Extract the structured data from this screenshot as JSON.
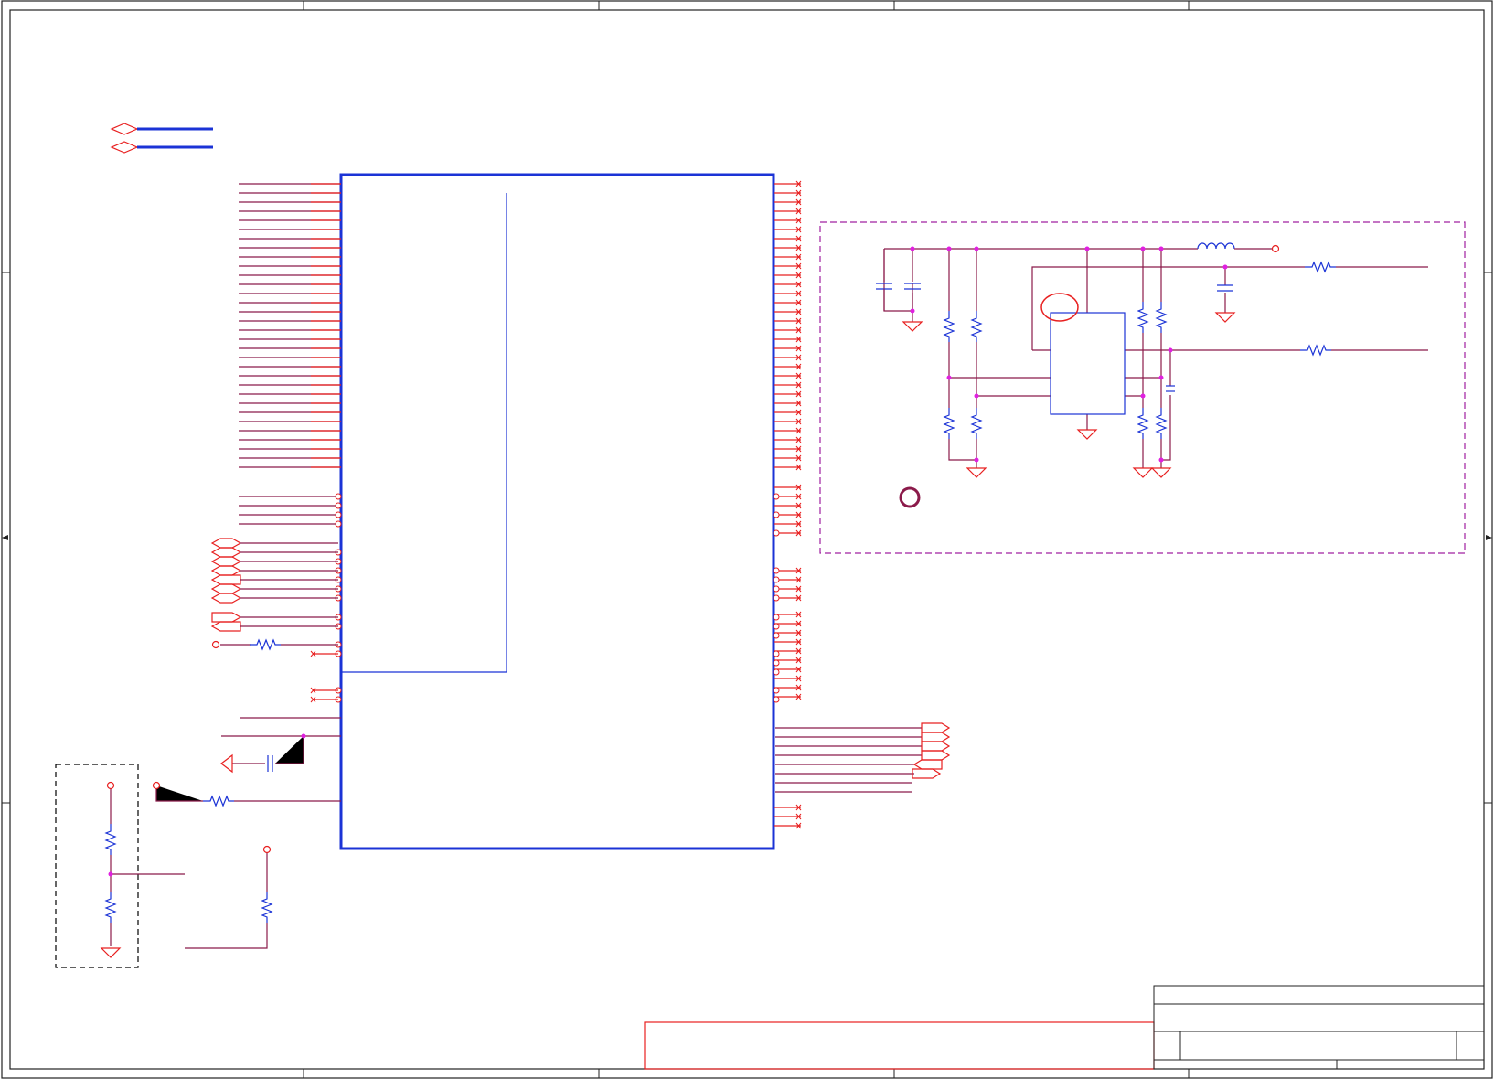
{
  "sheet": {
    "grid": "4x4 zoned frame",
    "text_labels": []
  },
  "colors": {
    "frame": "#222222",
    "net_wire": "#8b1a4a",
    "pin_stub": "#e82020",
    "component": "#1b33d6",
    "junction": "#e020e0",
    "boundary": "#a020a0",
    "subcircuit_box": "#000000"
  },
  "parts": {
    "main_ic": "large-ic-symbol",
    "regulator_ic": "regulator-ic-symbol",
    "title_block": "title-block-frame",
    "red_note_box": "red-annotation-box"
  },
  "icons": [
    "ground-symbol",
    "resistor-symbol",
    "capacitor-symbol",
    "inductor-symbol",
    "off-page-connector-icon",
    "no-connect-mark"
  ]
}
